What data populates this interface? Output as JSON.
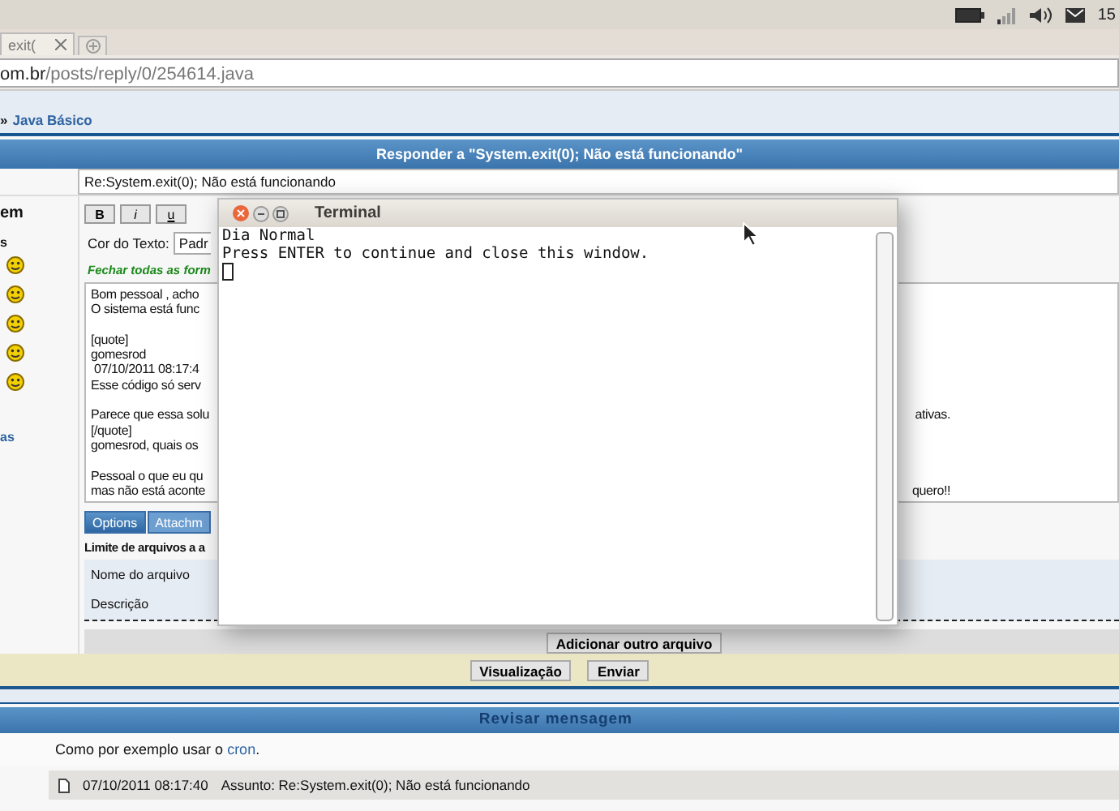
{
  "system_panel": {
    "clock": "15"
  },
  "browser": {
    "tab_title": "exit(",
    "url_host": "om.br",
    "url_path": "/posts/reply/0/254614.java"
  },
  "breadcrumb": {
    "separator": "»",
    "link": "Java Básico"
  },
  "form": {
    "title": "Responder a \"System.exit(0); Não está funcionando\"",
    "subject_value": "Re:System.exit(0); Não está funcionando",
    "side_labels": [
      "em",
      "s"
    ],
    "side_link": "as",
    "toolbar": [
      "B",
      "i",
      "u"
    ],
    "color_label": "Cor do Texto:",
    "color_select": "Padr",
    "close_tags": "Fechar todas as form",
    "message_paragraphs": [
      {
        "lines": [
          {
            "left": "Bom pessoal , acho"
          },
          {
            "left": "O sistema está func"
          }
        ]
      },
      {
        "lines": [
          {
            "left": "[quote]"
          },
          {
            "left": "gomesrod"
          },
          {
            "left": " 07/10/2011 08:17:4"
          },
          {
            "left": "Esse código só serv"
          }
        ]
      },
      {
        "lines": [
          {
            "left": "Parece que essa solu",
            "right": "ativas."
          },
          {
            "left": "[/quote]"
          },
          {
            "left": "gomesrod, quais os"
          }
        ]
      },
      {
        "lines": [
          {
            "left": "Pessoal o que eu qu"
          },
          {
            "left": "mas não está aconte",
            "right": "quero!!"
          }
        ]
      }
    ],
    "tabs": [
      {
        "label": "Options",
        "selected": true
      },
      {
        "label": "Attachm",
        "selected": false
      }
    ],
    "limit": "Limite de arquivos a a",
    "file_labels": [
      "Nome do arquivo",
      "Descrição"
    ],
    "add_button": "Adicionar outro arquivo",
    "buttons": [
      "Visualização",
      "Enviar"
    ]
  },
  "review": {
    "title": "Revisar mensagem",
    "text_before": "Como por exemplo usar o ",
    "link": "cron",
    "text_after": ".",
    "post_date": "07/10/2011 08:17:40",
    "post_subject": "Assunto:  Re:System.exit(0); Não está funcionando"
  },
  "terminal": {
    "title": "Terminal",
    "lines": [
      "Dia Normal",
      "Press ENTER to continue and close this window."
    ]
  }
}
